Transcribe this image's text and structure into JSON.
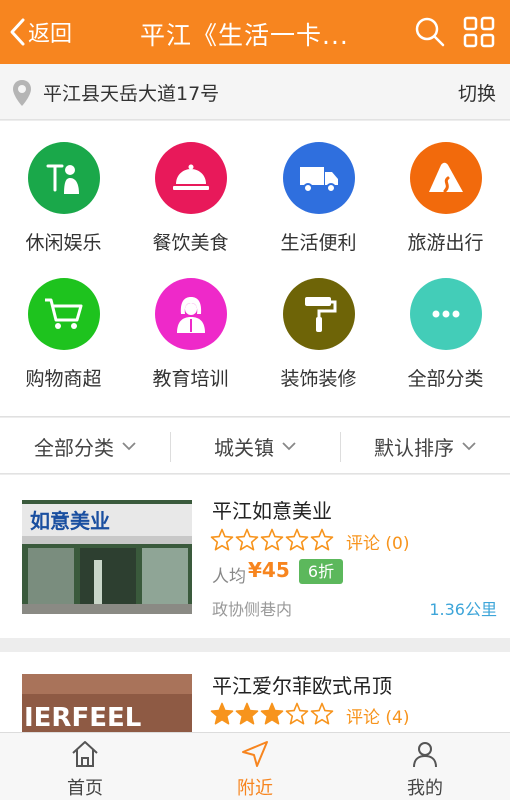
{
  "header": {
    "back_label": "返回",
    "title": "平江《生活一卡..."
  },
  "location": {
    "address": "平江县天岳大道17号",
    "switch_label": "切换"
  },
  "categories": [
    {
      "label": "休闲娱乐",
      "icon": "leisure-icon",
      "color": "#1aa84a"
    },
    {
      "label": "餐饮美食",
      "icon": "food-cloche-icon",
      "color": "#e8195a"
    },
    {
      "label": "生活便利",
      "icon": "truck-icon",
      "color": "#2f6fde"
    },
    {
      "label": "旅游出行",
      "icon": "mountain-icon",
      "color": "#f26a0c"
    },
    {
      "label": "购物商超",
      "icon": "cart-icon",
      "color": "#1ec31e"
    },
    {
      "label": "教育培训",
      "icon": "teacher-icon",
      "color": "#ee29c9"
    },
    {
      "label": "装饰装修",
      "icon": "paint-roller-icon",
      "color": "#6e6407"
    },
    {
      "label": "全部分类",
      "icon": "more-dots-icon",
      "color": "#43cdb8"
    }
  ],
  "filters": {
    "category": "全部分类",
    "area": "城关镇",
    "sort": "默认排序"
  },
  "shops": [
    {
      "name": "平江如意美业",
      "rating": 0,
      "review_label": "评论",
      "review_count": "(0)",
      "per_label": "人均",
      "price": "¥45",
      "discount": "6折",
      "area": "政协侧巷内",
      "distance": "1.36公里",
      "sign_text": "如意美业"
    },
    {
      "name": "平江爱尔菲欧式吊顶",
      "rating": 3,
      "review_label": "评论",
      "review_count": "(4)",
      "sign_text": "IERFEEL"
    }
  ],
  "tabs": [
    {
      "label": "首页",
      "icon": "home-icon"
    },
    {
      "label": "附近",
      "icon": "navigation-arrow-icon"
    },
    {
      "label": "我的",
      "icon": "user-icon"
    }
  ],
  "colors": {
    "brand_orange": "#f7851f",
    "star_orange": "#f7941d",
    "discount_green": "#5cb85c",
    "distance_blue": "#3da5d9"
  }
}
